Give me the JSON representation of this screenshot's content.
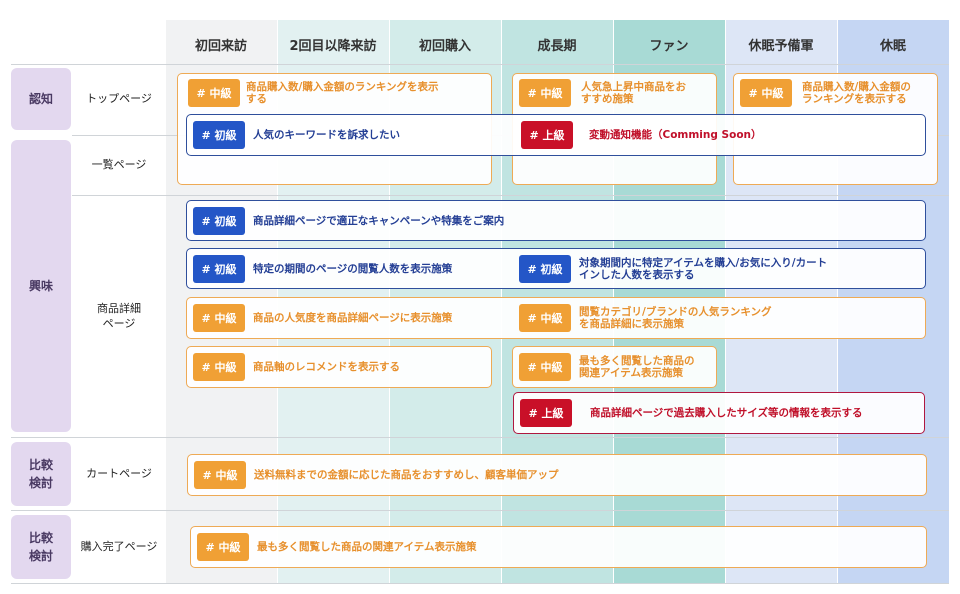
{
  "columns": [
    {
      "label": "初回来訪",
      "color": "#f1f2f3"
    },
    {
      "label": "2回目以降来訪",
      "color": "#e2f1f1"
    },
    {
      "label": "初回購入",
      "color": "#d3ecea"
    },
    {
      "label": "成長期",
      "color": "#c0e4e1"
    },
    {
      "label": "ファン",
      "color": "#a8dad5"
    },
    {
      "label": "休眠予備軍",
      "color": "#dde6f6"
    },
    {
      "label": "休眠",
      "color": "#c5d6f3"
    }
  ],
  "stages": [
    {
      "label": "認知"
    },
    {
      "label": "興味"
    },
    {
      "label": "比較\n検討"
    },
    {
      "label": "比較\n検討"
    }
  ],
  "pages": [
    {
      "label": "トップページ"
    },
    {
      "label": "一覧ページ"
    },
    {
      "label": "商品詳細\nページ"
    },
    {
      "label": "カートページ"
    },
    {
      "label": "購入完了ページ"
    }
  ],
  "levels": {
    "mid": "# 中級",
    "beg": "# 初級",
    "adv": "# 上級"
  },
  "colors": {
    "mid": "#f0a035",
    "beg": "#2456c7",
    "adv": "#c91028"
  },
  "cards": [
    {
      "level": "mid",
      "text": "商品購入数/購入金額のランキングを表示\nする"
    },
    {
      "level": "mid",
      "text": "人気急上昇中商品をお\nすすめ施策"
    },
    {
      "level": "mid",
      "text": "商品購入数/購入金額の\nランキングを表示する"
    },
    {
      "level": "beg",
      "text": "人気のキーワードを訴求したい"
    },
    {
      "level": "adv",
      "text": "変動通知機能（Comming Soon）"
    },
    {
      "level": "beg",
      "text": "商品詳細ページで適正なキャンペーンや特集をご案内"
    },
    {
      "level": "beg",
      "text": "特定の期間のページの閲覧人数を表示施策"
    },
    {
      "level": "beg",
      "text": "対象期間内に特定アイテムを購入/お気に入り/カート\nインした人数を表示する"
    },
    {
      "level": "mid",
      "text": "商品の人気度を商品詳細ページに表示施策"
    },
    {
      "level": "mid",
      "text": "閲覧カテゴリ/ブランドの人気ランキング\nを商品詳細に表示施策"
    },
    {
      "level": "mid",
      "text": "商品軸のレコメンドを表示する"
    },
    {
      "level": "mid",
      "text": "最も多く閲覧した商品の\n関連アイテム表示施策"
    },
    {
      "level": "adv",
      "text": "商品詳細ページで過去購入したサイズ等の情報を表示する"
    },
    {
      "level": "mid",
      "text": "送料無料までの金額に応じた商品をおすすめし、顧客単価アップ"
    },
    {
      "level": "mid",
      "text": "最も多く閲覧した商品の関連アイテム表示施策"
    }
  ]
}
